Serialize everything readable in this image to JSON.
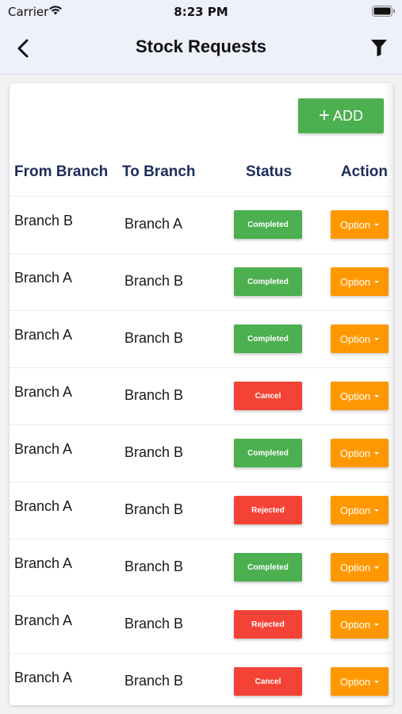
{
  "status_bar": {
    "carrier": "Carrier",
    "time": "8:23 PM"
  },
  "navbar": {
    "title": "Stock Requests",
    "back_icon": "chevron-left-icon",
    "filter_icon": "filter-icon"
  },
  "toolbar": {
    "add_label": "ADD",
    "add_icon": "plus-icon"
  },
  "table": {
    "headers": {
      "from": "From Branch",
      "to": "To Branch",
      "status": "Status",
      "action": "Action"
    },
    "rows": [
      {
        "from": "Branch B",
        "to": "Branch A",
        "status": "Completed",
        "action": "Option"
      },
      {
        "from": "Branch A",
        "to": "Branch B",
        "status": "Completed",
        "action": "Option"
      },
      {
        "from": "Branch A",
        "to": "Branch B",
        "status": "Completed",
        "action": "Option"
      },
      {
        "from": "Branch A",
        "to": "Branch B",
        "status": "Cancel",
        "action": "Option"
      },
      {
        "from": "Branch A",
        "to": "Branch B",
        "status": "Completed",
        "action": "Option"
      },
      {
        "from": "Branch A",
        "to": "Branch B",
        "status": "Rejected",
        "action": "Option"
      },
      {
        "from": "Branch A",
        "to": "Branch B",
        "status": "Completed",
        "action": "Option"
      },
      {
        "from": "Branch A",
        "to": "Branch B",
        "status": "Rejected",
        "action": "Option"
      },
      {
        "from": "Branch A",
        "to": "Branch B",
        "status": "Cancel",
        "action": "Option"
      }
    ]
  },
  "colors": {
    "navbar_bg": "#eef0fa",
    "header_text": "#1c2d5c",
    "add_button": "#4caf50",
    "completed": "#4caf50",
    "cancel": "#f44336",
    "rejected": "#f44336",
    "option_button": "#ff9800"
  }
}
